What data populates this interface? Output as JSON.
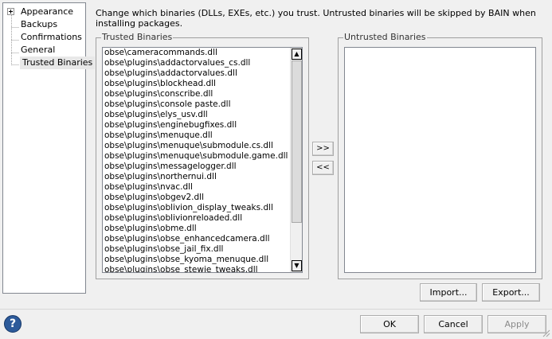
{
  "tree": {
    "items": [
      {
        "label": "Appearance",
        "expandable": true
      },
      {
        "label": "Backups"
      },
      {
        "label": "Confirmations"
      },
      {
        "label": "General"
      },
      {
        "label": "Trusted Binaries",
        "selected": true
      }
    ]
  },
  "description": "Change which binaries (DLLs, EXEs, etc.) you trust. Untrusted binaries will be skipped by BAIN when installing packages.",
  "trusted": {
    "label": "Trusted Binaries",
    "items": [
      "obse\\cameracommands.dll",
      "obse\\plugins\\addactorvalues_cs.dll",
      "obse\\plugins\\addactorvalues.dll",
      "obse\\plugins\\blockhead.dll",
      "obse\\plugins\\conscribe.dll",
      "obse\\plugins\\console paste.dll",
      "obse\\plugins\\elys_usv.dll",
      "obse\\plugins\\enginebugfixes.dll",
      "obse\\plugins\\menuque.dll",
      "obse\\plugins\\menuque\\submodule.cs.dll",
      "obse\\plugins\\menuque\\submodule.game.dll",
      "obse\\plugins\\messagelogger.dll",
      "obse\\plugins\\northernui.dll",
      "obse\\plugins\\nvac.dll",
      "obse\\plugins\\obgev2.dll",
      "obse\\plugins\\oblivion_display_tweaks.dll",
      "obse\\plugins\\oblivionreloaded.dll",
      "obse\\plugins\\obme.dll",
      "obse\\plugins\\obse_enhancedcamera.dll",
      "obse\\plugins\\obse_jail_fix.dll",
      "obse\\plugins\\obse_kyoma_menuque.dll",
      "obse\\plugins\\obse_stewie_tweaks.dll"
    ]
  },
  "untrusted": {
    "label": "Untrusted Binaries",
    "items": []
  },
  "move": {
    "to_untrusted": ">>",
    "to_trusted": "<<"
  },
  "buttons": {
    "import": "Import...",
    "export": "Export...",
    "ok": "OK",
    "cancel": "Cancel",
    "apply": "Apply"
  },
  "help": {
    "glyph": "?"
  },
  "icons": {
    "help": "help-icon",
    "expand": "expand-icon"
  },
  "colors": {
    "help_blue": "#2c5a9a",
    "window_bg": "#f0f0f0"
  }
}
